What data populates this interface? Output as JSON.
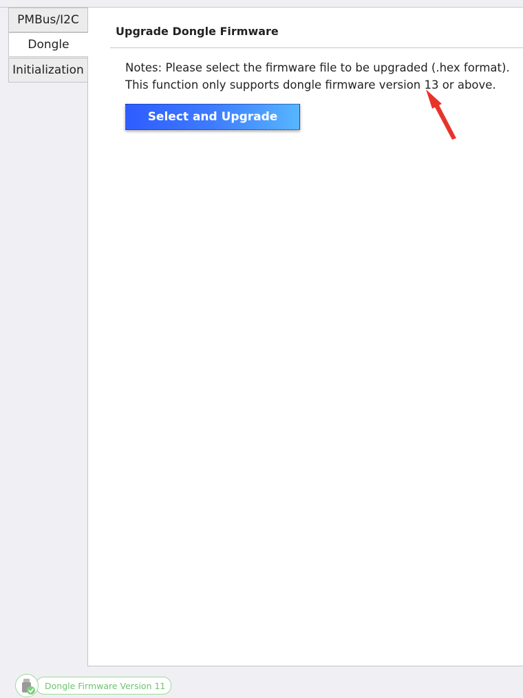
{
  "tabs": [
    {
      "label": "PMBus/I2C",
      "active": false
    },
    {
      "label": "Dongle",
      "active": true
    },
    {
      "label": "Initialization",
      "active": false
    }
  ],
  "section": {
    "title": "Upgrade Dongle Firmware",
    "note_line1": "Notes: Please select the firmware file to be upgraded (.hex format).",
    "note_line2": "This function only supports dongle firmware version 13 or above.",
    "button_label": "Select and Upgrade"
  },
  "status": {
    "version_text": "Dongle Firmware Version 11",
    "icon": "usb-dongle-connected-icon"
  },
  "colors": {
    "button_gradient_start": "#2f5cff",
    "button_gradient_end": "#57b6ff",
    "status_green": "#6cc46c",
    "annotation_red": "#e8332a"
  }
}
